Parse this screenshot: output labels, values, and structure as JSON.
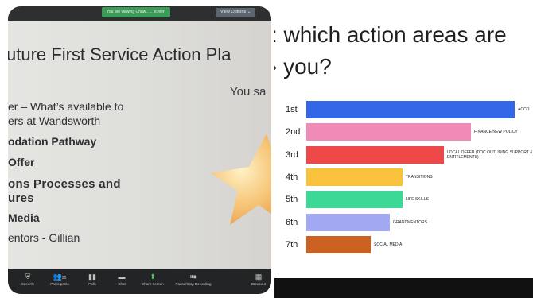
{
  "zoom": {
    "banner": "You are viewing Chaw.. ... screen",
    "view_options": "View Options ⌄",
    "toolbar": [
      {
        "label": "Security",
        "icon": "shield-icon"
      },
      {
        "label": "Participants",
        "icon": "participants-icon",
        "count": "25"
      },
      {
        "label": "Polls",
        "icon": "polls-icon"
      },
      {
        "label": "Chat",
        "icon": "chat-icon"
      },
      {
        "label": "Share Screen",
        "icon": "share-screen-icon"
      },
      {
        "label": "Pause/Stop Recording",
        "icon": "recording-icon"
      },
      {
        "label": "Breakout",
        "icon": "breakout-icon"
      }
    ]
  },
  "slide": {
    "title": "uture First Service Action Pla",
    "you_said": "You sa",
    "bullets": [
      "er – What’s available to",
      "ers at Wandsworth",
      "odation Pathway",
      "Offer",
      "ons  Processes  and",
      "ures",
      "Media",
      "entors - Gillian"
    ]
  },
  "menti": {
    "question_line1": ": which action areas are",
    "question_line2": "› you?",
    "colors": {
      "blue": "#3466e8",
      "pink": "#f08ab6",
      "red": "#ef4848",
      "yellow": "#f8c23c",
      "green": "#3bd896",
      "purple": "#a3a8f2",
      "orange": "#cc6222"
    }
  },
  "chart_data": {
    "type": "bar",
    "orientation": "horizontal",
    "categories": [
      "1st",
      "2nd",
      "3rd",
      "4th",
      "5th",
      "6th",
      "7th"
    ],
    "labels": [
      "ACCO",
      "FINANCE/NEW POLICY",
      "LOCAL OFFER (DOC OUTLINING SUPPORT & ENTITLEMENTS)",
      "TRANSITIONS",
      "LIFE SKILLS",
      "GRANDMENTORS",
      "SOCIAL MEDIA"
    ],
    "values": [
      100,
      79,
      66,
      46,
      46,
      40,
      31
    ],
    "colors": [
      "#3466e8",
      "#f08ab6",
      "#ef4848",
      "#f8c23c",
      "#3bd896",
      "#a3a8f2",
      "#cc6222"
    ]
  }
}
